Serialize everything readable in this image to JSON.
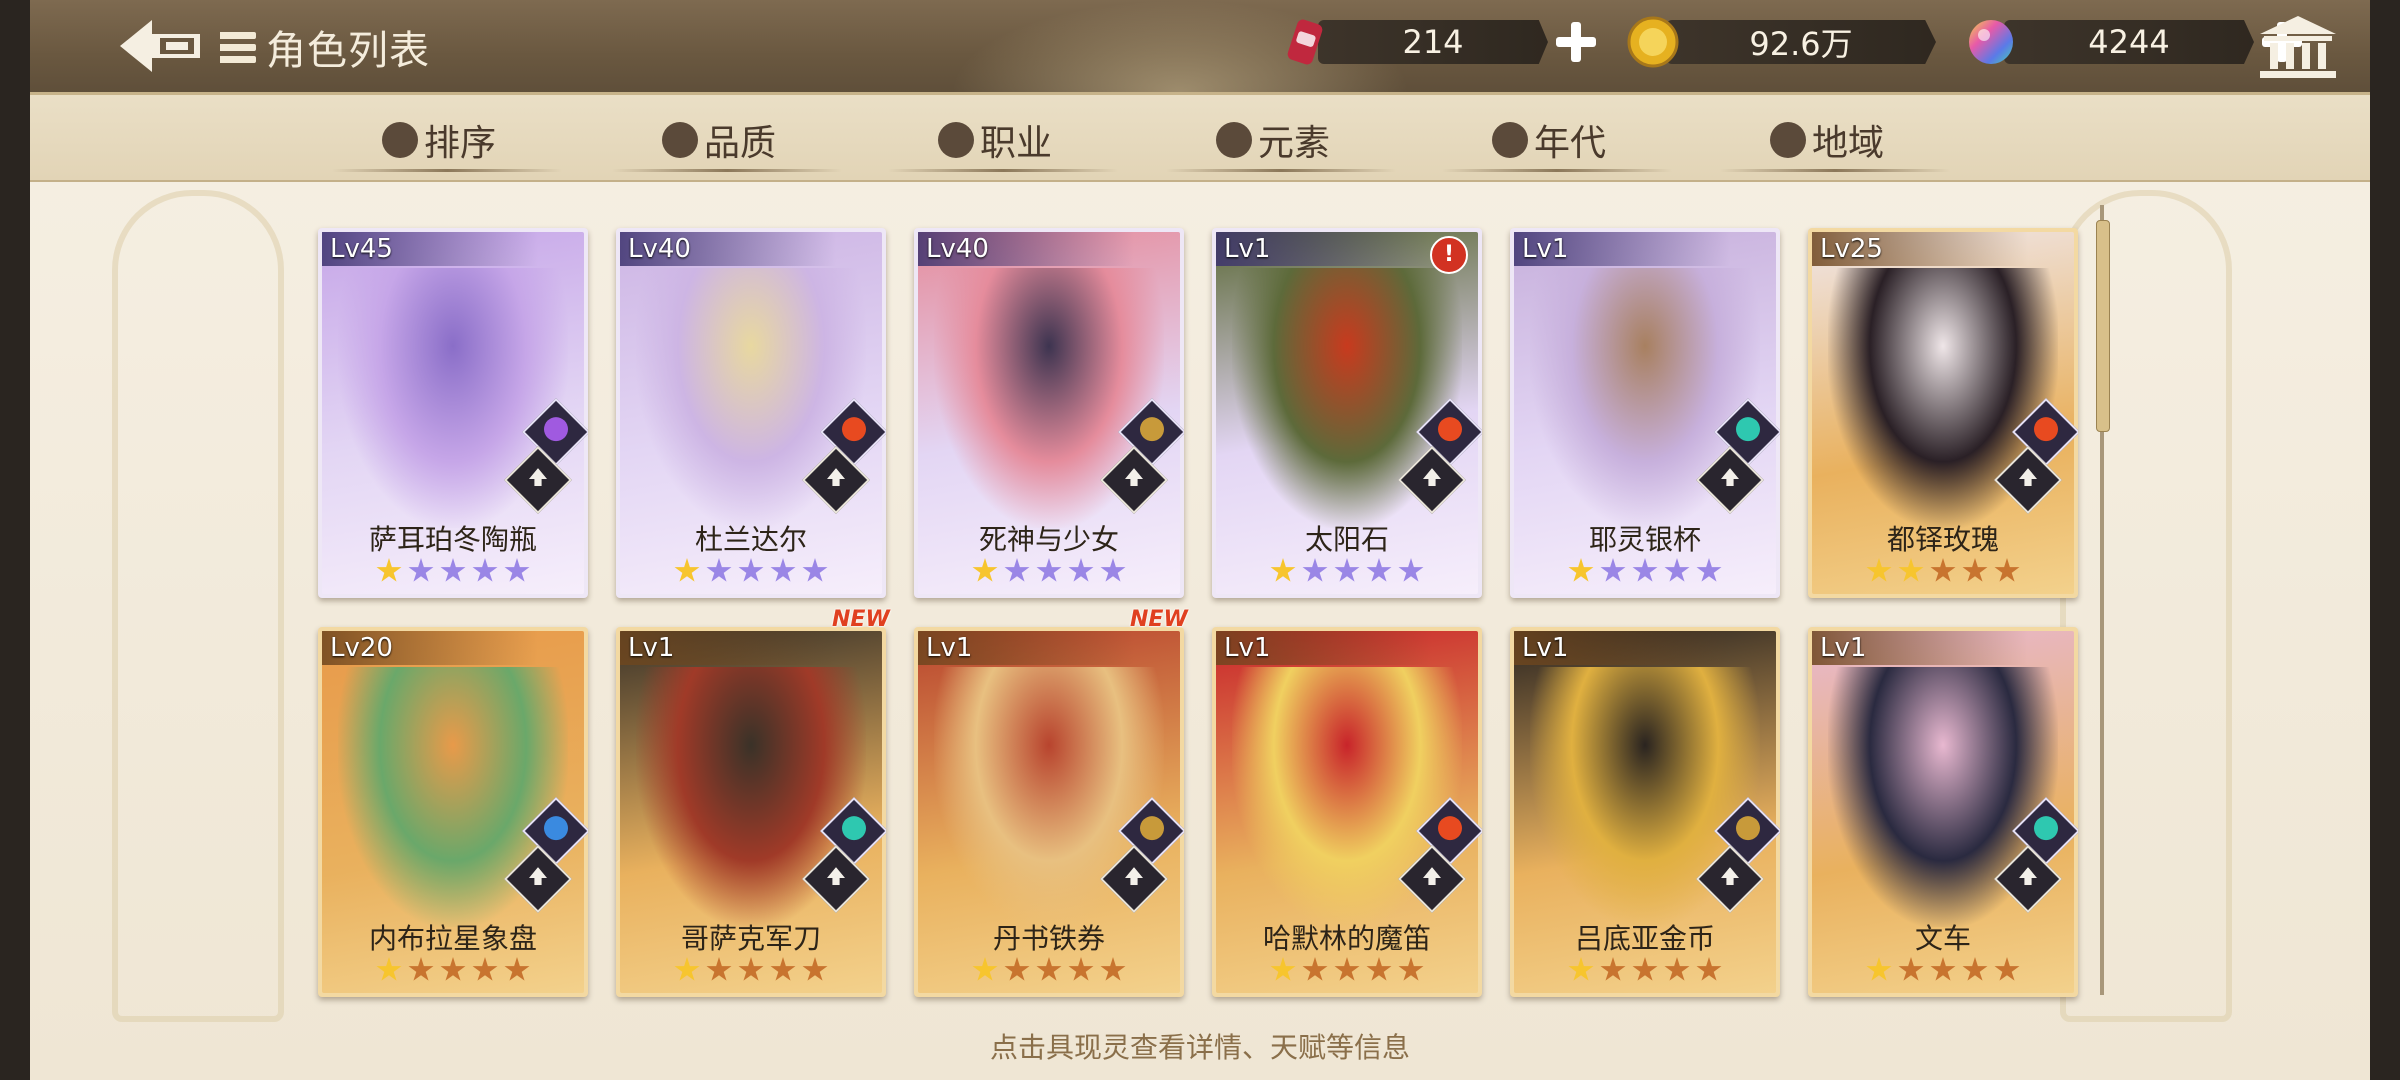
{
  "header": {
    "title": "角色列表",
    "currencies": [
      {
        "icon": "energy-drink-icon",
        "value": "214",
        "color": "#c0283e"
      },
      {
        "icon": "gold-coin-icon",
        "value": "92.6万",
        "color": "#e6b120"
      },
      {
        "icon": "rainbow-gem-icon",
        "value": "4244",
        "color": "#9a6ad6"
      }
    ]
  },
  "filters": [
    {
      "label": "排序",
      "icon": "sort-icon"
    },
    {
      "label": "品质",
      "icon": "quality-icon"
    },
    {
      "label": "职业",
      "icon": "class-icon"
    },
    {
      "label": "元素",
      "icon": "element-icon"
    },
    {
      "label": "年代",
      "icon": "era-icon"
    },
    {
      "label": "地域",
      "icon": "region-icon"
    }
  ],
  "cards": [
    {
      "level": "Lv45",
      "name": "萨耳珀冬陶瓶",
      "stars": 1,
      "max_stars": 5,
      "rarity": "purple",
      "element": "lightning",
      "element_color": "#a05ae0",
      "job": "lance",
      "new": false,
      "alert": false,
      "palette": [
        "#8a6ec8",
        "#c6a6e8"
      ]
    },
    {
      "level": "Lv40",
      "name": "杜兰达尔",
      "stars": 1,
      "max_stars": 5,
      "rarity": "purple",
      "element": "fire",
      "element_color": "#e84a20",
      "job": "shield",
      "new": false,
      "alert": false,
      "palette": [
        "#e8d8a0",
        "#cdb5e4"
      ]
    },
    {
      "level": "Lv40",
      "name": "死神与少女",
      "stars": 1,
      "max_stars": 5,
      "rarity": "purple",
      "element": "earth",
      "element_color": "#c89a3a",
      "job": "lance",
      "new": false,
      "alert": false,
      "palette": [
        "#3d3450",
        "#e58c9c"
      ]
    },
    {
      "level": "Lv1",
      "name": "太阳石",
      "stars": 1,
      "max_stars": 5,
      "rarity": "purple",
      "element": "fire",
      "element_color": "#e84a20",
      "job": "sword",
      "new": false,
      "alert": true,
      "palette": [
        "#c83a1e",
        "#5d6a3a"
      ]
    },
    {
      "level": "Lv1",
      "name": "耶灵银杯",
      "stars": 1,
      "max_stars": 5,
      "rarity": "purple",
      "element": "wind",
      "element_color": "#2ec8b0",
      "job": "crossed-swords",
      "new": false,
      "alert": false,
      "palette": [
        "#a88060",
        "#c7b0dc"
      ]
    },
    {
      "level": "Lv25",
      "name": "都铎玫瑰",
      "stars": 2,
      "max_stars": 5,
      "rarity": "gold",
      "element": "fire",
      "element_color": "#e84a20",
      "job": "sword",
      "new": false,
      "alert": false,
      "palette": [
        "#efe6e8",
        "#2a2026"
      ]
    },
    {
      "level": "Lv20",
      "name": "内布拉星象盘",
      "stars": 1,
      "max_stars": 5,
      "rarity": "gold",
      "element": "water",
      "element_color": "#3a8ae0",
      "job": "staff",
      "new": false,
      "alert": false,
      "palette": [
        "#e89a4a",
        "#6aa86a"
      ]
    },
    {
      "level": "Lv1",
      "name": "哥萨克军刀",
      "stars": 1,
      "max_stars": 5,
      "rarity": "gold",
      "element": "wind",
      "element_color": "#2ec8b0",
      "job": "crossed-swords",
      "new": true,
      "alert": false,
      "palette": [
        "#3a3228",
        "#a03a28"
      ]
    },
    {
      "level": "Lv1",
      "name": "丹书铁券",
      "stars": 1,
      "max_stars": 5,
      "rarity": "gold",
      "element": "earth",
      "element_color": "#c89a3a",
      "job": "shield",
      "new": true,
      "alert": false,
      "palette": [
        "#b8442e",
        "#e8c080"
      ]
    },
    {
      "level": "Lv1",
      "name": "哈默林的魔笛",
      "stars": 1,
      "max_stars": 5,
      "rarity": "gold",
      "element": "fire",
      "element_color": "#e84a20",
      "job": "sword",
      "new": false,
      "alert": false,
      "palette": [
        "#c8242a",
        "#f0d060"
      ]
    },
    {
      "level": "Lv1",
      "name": "吕底亚金币",
      "stars": 1,
      "max_stars": 5,
      "rarity": "gold",
      "element": "earth",
      "element_color": "#c89a3a",
      "job": "lance",
      "new": false,
      "alert": false,
      "palette": [
        "#2a2420",
        "#e0b040"
      ]
    },
    {
      "level": "Lv1",
      "name": "文车",
      "stars": 1,
      "max_stars": 5,
      "rarity": "gold",
      "element": "wind",
      "element_color": "#2ec8b0",
      "job": "book",
      "new": false,
      "alert": false,
      "palette": [
        "#e8b8d0",
        "#2a2a40"
      ]
    }
  ],
  "labels": {
    "new": "NEW",
    "alert": "!"
  },
  "hint": "点击具现灵查看详情、天赋等信息",
  "ui_colors": {
    "topbar": "#6a5840",
    "tabbar": "#e6d9bd",
    "accent_gold": "#d8c08a",
    "text_dark": "#4a3a2c"
  }
}
